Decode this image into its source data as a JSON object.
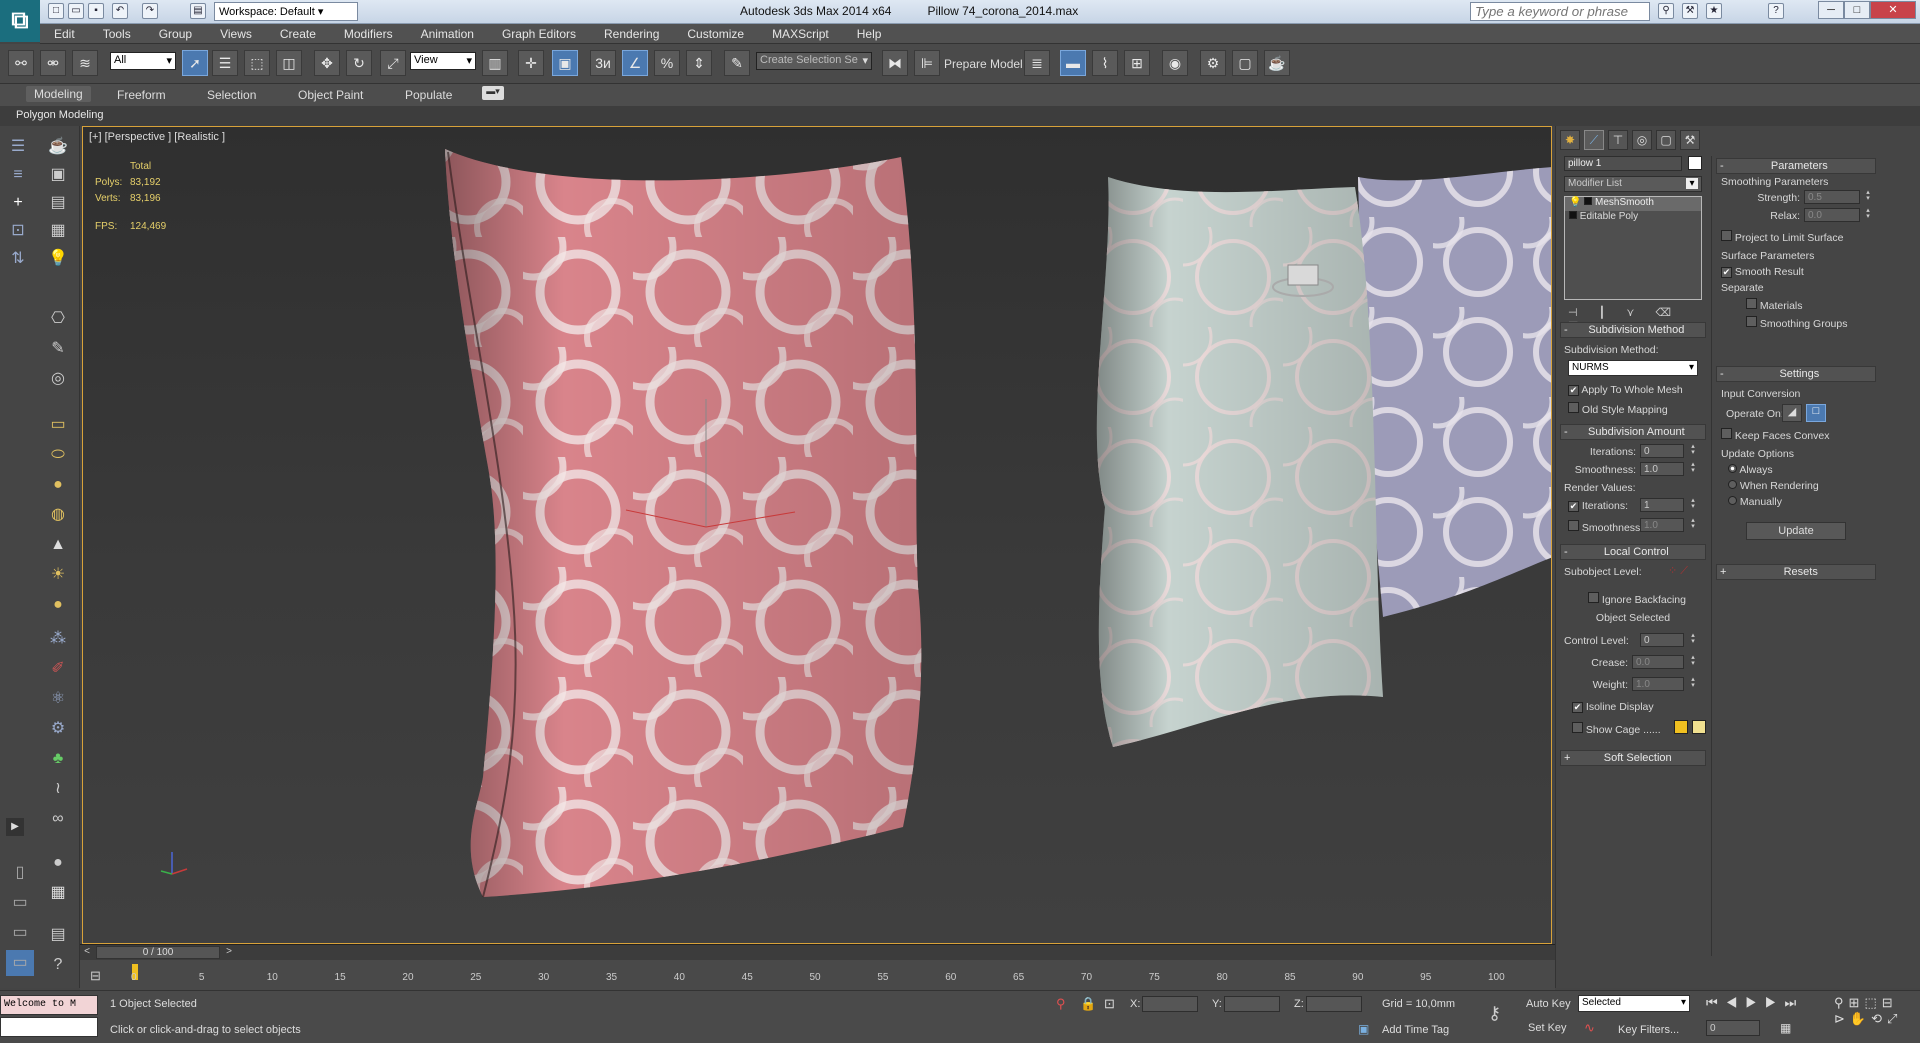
{
  "titlebar": {
    "workspace": "Workspace: Default",
    "app_title": "Autodesk 3ds Max  2014 x64",
    "file_title": "Pillow 74_corona_2014.max",
    "search_placeholder": "Type a keyword or phrase"
  },
  "menu": [
    "Edit",
    "Tools",
    "Group",
    "Views",
    "Create",
    "Modifiers",
    "Animation",
    "Graph Editors",
    "Rendering",
    "Customize",
    "MAXScript",
    "Help"
  ],
  "toolbar": {
    "selection_filter": "All",
    "ref_coord": "View",
    "named_selection": "Create Selection Se",
    "prepare_model": "Prepare Model",
    "snap_label": "3"
  },
  "ribbon": {
    "tabs": [
      "Modeling",
      "Freeform",
      "Selection",
      "Object Paint",
      "Populate"
    ],
    "active": "Modeling",
    "subpanel": "Polygon Modeling"
  },
  "viewport": {
    "label": "[+] [Perspective ] [Realistic ]",
    "stats": {
      "total_label": "Total",
      "polys_label": "Polys:",
      "polys": "83,192",
      "verts_label": "Verts:",
      "verts": "83,196",
      "fps_label": "FPS:",
      "fps": "124,469"
    },
    "colors": {
      "pillow_pink": "#d9848b",
      "pillow_mint": "#c6d3cf",
      "pillow_lavender": "#9c9bb8",
      "pattern": "#f0e7e6"
    }
  },
  "command_panel": {
    "object_name": "pillow 1",
    "modifier_list": "Modifier List",
    "stack": [
      "MeshSmooth",
      "Editable Poly"
    ],
    "subdivision_method": {
      "title": "Subdivision Method",
      "label": "Subdivision Method:",
      "value": "NURMS",
      "apply_whole_mesh": "Apply To Whole Mesh",
      "old_style": "Old Style Mapping"
    },
    "subdivision_amount": {
      "title": "Subdivision Amount",
      "iterations_label": "Iterations:",
      "iterations": "0",
      "smoothness_label": "Smoothness:",
      "smoothness": "1.0",
      "render_values": "Render Values:",
      "r_iterations_label": "Iterations:",
      "r_iterations": "1",
      "r_smoothness_label": "Smoothness:",
      "r_smoothness": "1.0"
    },
    "local_control": {
      "title": "Local Control",
      "subobject_level": "Subobject Level:",
      "ignore_backfacing": "Ignore Backfacing",
      "object_selected": "Object Selected",
      "control_level_label": "Control Level:",
      "control_level": "0",
      "crease_label": "Crease:",
      "crease": "0.0",
      "weight_label": "Weight:",
      "weight": "1.0",
      "isoline": "Isoline Display",
      "show_cage": "Show Cage ......"
    },
    "soft_selection": "Soft Selection"
  },
  "params_panel": {
    "title": "Parameters",
    "smoothing_params": "Smoothing Parameters",
    "strength_label": "Strength:",
    "strength": "0.5",
    "relax_label": "Relax:",
    "relax": "0.0",
    "project_limit": "Project to Limit Surface",
    "surface_params": "Surface Parameters",
    "smooth_result": "Smooth Result",
    "separate": "Separate",
    "materials": "Materials",
    "smoothing_groups": "Smoothing Groups",
    "settings": "Settings",
    "input_conversion": "Input Conversion",
    "operate_on": "Operate On:",
    "keep_faces_convex": "Keep Faces Convex",
    "update_options": "Update Options",
    "always": "Always",
    "when_rendering": "When Rendering",
    "manually": "Manually",
    "update_btn": "Update",
    "resets": "Resets"
  },
  "timeline": {
    "frame": "0 / 100",
    "ticks": [
      "0",
      "5",
      "10",
      "15",
      "20",
      "25",
      "30",
      "35",
      "40",
      "45",
      "50",
      "55",
      "60",
      "65",
      "70",
      "75",
      "80",
      "85",
      "90",
      "95",
      "100"
    ]
  },
  "status": {
    "maxscript": "Welcome to M",
    "selected": "1 Object Selected",
    "prompt": "Click or click-and-drag to select objects",
    "x_label": "X:",
    "y_label": "Y:",
    "z_label": "Z:",
    "grid": "Grid = 10,0mm",
    "add_time_tag": "Add Time Tag",
    "auto_key": "Auto Key",
    "set_key": "Set Key",
    "selected_dropdown": "Selected",
    "key_filters": "Key Filters...",
    "frame_value": "0"
  }
}
